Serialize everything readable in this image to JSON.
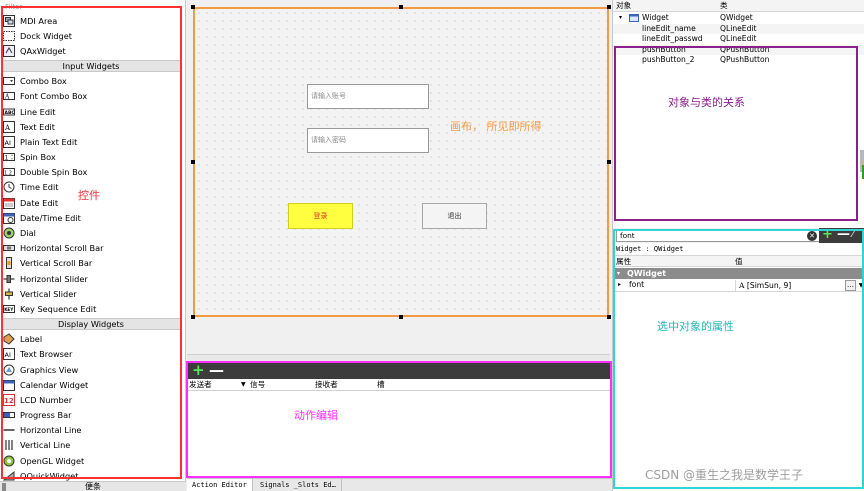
{
  "widget_box": {
    "filter_placeholder": "Filter",
    "items_top": [
      {
        "label": "MDI Area",
        "icon": "mdi-area-icon"
      },
      {
        "label": "Dock Widget",
        "icon": "dock-widget-icon"
      },
      {
        "label": "QAxWidget",
        "icon": "qaxwidget-icon"
      }
    ],
    "category_input": "Input Widgets",
    "items_input": [
      {
        "label": "Combo Box",
        "icon": "combo-box-icon"
      },
      {
        "label": "Font Combo Box",
        "icon": "font-combo-box-icon"
      },
      {
        "label": "Line Edit",
        "icon": "line-edit-icon"
      },
      {
        "label": "Text Edit",
        "icon": "text-edit-icon"
      },
      {
        "label": "Plain Text Edit",
        "icon": "plain-text-edit-icon"
      },
      {
        "label": "Spin Box",
        "icon": "spin-box-icon"
      },
      {
        "label": "Double Spin Box",
        "icon": "double-spin-box-icon"
      },
      {
        "label": "Time Edit",
        "icon": "time-edit-icon"
      },
      {
        "label": "Date Edit",
        "icon": "date-edit-icon"
      },
      {
        "label": "Date/Time Edit",
        "icon": "datetime-edit-icon"
      },
      {
        "label": "Dial",
        "icon": "dial-icon"
      },
      {
        "label": "Horizontal Scroll Bar",
        "icon": "horizontal-scroll-bar-icon"
      },
      {
        "label": "Vertical Scroll Bar",
        "icon": "vertical-scroll-bar-icon"
      },
      {
        "label": "Horizontal Slider",
        "icon": "horizontal-slider-icon"
      },
      {
        "label": "Vertical Slider",
        "icon": "vertical-slider-icon"
      },
      {
        "label": "Key Sequence Edit",
        "icon": "key-sequence-edit-icon"
      }
    ],
    "category_display": "Display Widgets",
    "items_display": [
      {
        "label": "Label",
        "icon": "label-icon"
      },
      {
        "label": "Text Browser",
        "icon": "text-browser-icon"
      },
      {
        "label": "Graphics View",
        "icon": "graphics-view-icon"
      },
      {
        "label": "Calendar Widget",
        "icon": "calendar-widget-icon"
      },
      {
        "label": "LCD Number",
        "icon": "lcd-number-icon"
      },
      {
        "label": "Progress Bar",
        "icon": "progress-bar-icon"
      },
      {
        "label": "Horizontal Line",
        "icon": "horizontal-line-icon"
      },
      {
        "label": "Vertical Line",
        "icon": "vertical-line-icon"
      },
      {
        "label": "OpenGL Widget",
        "icon": "opengl-widget-icon"
      },
      {
        "label": "QQuickWidget",
        "icon": "qquickwidget-icon"
      }
    ],
    "bottom_tab": "便条"
  },
  "canvas": {
    "username_placeholder": "请输入账号",
    "password_placeholder": "请输入密码",
    "login_button": "登录",
    "exit_button": "退出"
  },
  "action_editor": {
    "columns": [
      "发送者",
      "信号",
      "接收者",
      "槽"
    ],
    "tabs": [
      "Action Editor",
      "Signals _Slots Ed…"
    ]
  },
  "object_inspector": {
    "headers": {
      "object": "对象",
      "class": "类"
    },
    "rows": [
      {
        "object": "Widget",
        "class": "QWidget"
      },
      {
        "object": "lineEdit_name",
        "class": "QLineEdit"
      },
      {
        "object": "lineEdit_passwd",
        "class": "QLineEdit"
      },
      {
        "object": "pushButton",
        "class": "QPushButton"
      },
      {
        "object": "pushButton_2",
        "class": "QPushButton"
      }
    ]
  },
  "property_editor": {
    "filter_value": "font",
    "class_line": "Widget : QWidget",
    "headers": {
      "property": "属性",
      "value": "值"
    },
    "group": "QWidget",
    "property": {
      "name": "font",
      "value": "[SimSun, 9]"
    }
  },
  "annotations": {
    "widgets": "控件",
    "canvas": "画布， 所见即所得",
    "action_editor": "动作编辑",
    "object_inspector": "对象与类的关系",
    "property_editor": "选中对象的属性"
  },
  "watermark": "CSDN @重生之我是数学王子",
  "colors": {
    "widgets_box": "#ff3030",
    "canvas_box": "#f39a45",
    "action_box": "#ff30ff",
    "object_box": "#8b1f8b",
    "property_box": "#32d4d4",
    "login_button_bg": "#ffff40"
  }
}
